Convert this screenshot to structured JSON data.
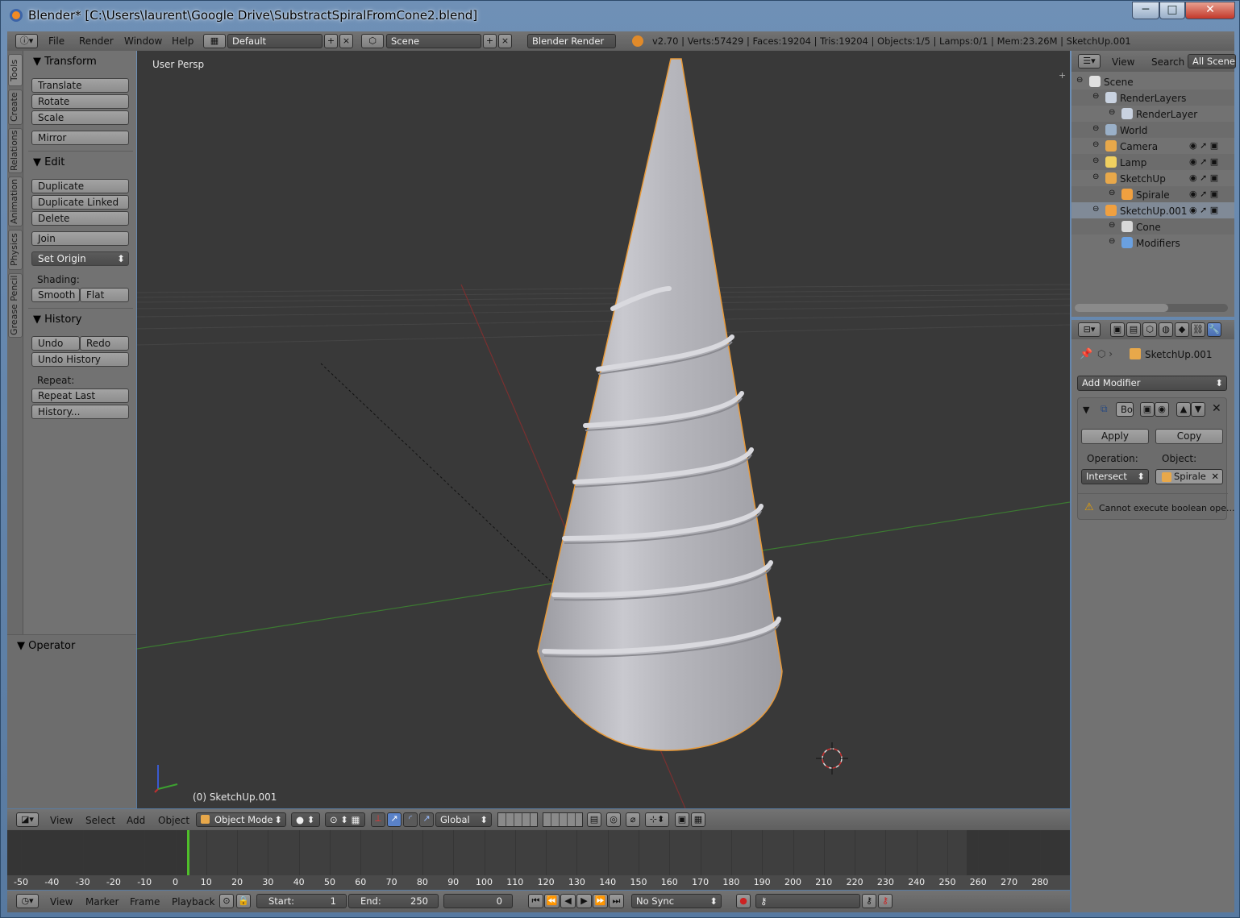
{
  "window": {
    "title": "Blender* [C:\\Users\\laurent\\Google Drive\\SubstractSpiralFromCone2.blend]",
    "controls": {
      "minimize": "─",
      "maximize": "□",
      "close": "✕"
    }
  },
  "topbar": {
    "menus": [
      "File",
      "Render",
      "Window",
      "Help"
    ],
    "layout": "Default",
    "scene": "Scene",
    "engine": "Blender Render",
    "stats": "v2.70 | Verts:57429 | Faces:19204 | Tris:19204 | Objects:1/5 | Lamps:0/1 | Mem:23.26M | SketchUp.001"
  },
  "toolshelf": {
    "tabs": [
      "Tools",
      "Create",
      "Relations",
      "Animation",
      "Physics",
      "Grease Pencil"
    ],
    "transform": {
      "title": "Transform",
      "buttons": [
        "Translate",
        "Rotate",
        "Scale",
        "Mirror"
      ]
    },
    "edit": {
      "title": "Edit",
      "buttons": [
        "Duplicate",
        "Duplicate Linked",
        "Delete",
        "Join"
      ],
      "set_origin": "Set Origin",
      "shading_label": "Shading:",
      "smooth": "Smooth",
      "flat": "Flat"
    },
    "history": {
      "title": "History",
      "undo": "Undo",
      "redo": "Redo",
      "undo_history": "Undo History",
      "repeat_label": "Repeat:",
      "repeat_last": "Repeat Last",
      "history_btn": "History..."
    },
    "operator": {
      "title": "Operator"
    }
  },
  "viewport": {
    "view_name": "User Persp",
    "object_label": "(0) SketchUp.001"
  },
  "outliner": {
    "menus": [
      "View",
      "Search",
      "All Scenes"
    ],
    "rows": [
      {
        "label": "Scene",
        "indent": 0
      },
      {
        "label": "RenderLayers",
        "indent": 1
      },
      {
        "label": "RenderLayer",
        "indent": 2
      },
      {
        "label": "World",
        "indent": 1
      },
      {
        "label": "Camera",
        "indent": 1
      },
      {
        "label": "Lamp",
        "indent": 1
      },
      {
        "label": "SketchUp",
        "indent": 1
      },
      {
        "label": "Spirale",
        "indent": 2
      },
      {
        "label": "SketchUp.001",
        "indent": 1
      },
      {
        "label": "Cone",
        "indent": 2
      },
      {
        "label": "Modifiers",
        "indent": 2
      }
    ]
  },
  "properties": {
    "object_name": "SketchUp.001",
    "add_modifier": "Add Modifier",
    "modifier_name": "Bo",
    "apply": "Apply",
    "copy": "Copy",
    "operation_label": "Operation:",
    "object_label": "Object:",
    "operation": "Intersect",
    "object": "Spirale",
    "warning": "Cannot execute boolean ope..."
  },
  "viewport_header": {
    "menus": [
      "View",
      "Select",
      "Add",
      "Object"
    ],
    "mode": "Object Mode",
    "orientation": "Global"
  },
  "timeline": {
    "ticks": [
      "-50",
      "-40",
      "-30",
      "-20",
      "-10",
      "0",
      "10",
      "20",
      "30",
      "40",
      "50",
      "60",
      "70",
      "80",
      "90",
      "100",
      "110",
      "120",
      "130",
      "140",
      "150",
      "160",
      "170",
      "180",
      "190",
      "200",
      "210",
      "220",
      "230",
      "240",
      "250",
      "260",
      "270",
      "280"
    ]
  },
  "timeline_header": {
    "menus": [
      "View",
      "Marker",
      "Frame",
      "Playback"
    ],
    "start_label": "Start:",
    "start": "1",
    "end_label": "End:",
    "end": "250",
    "current": "0",
    "sync": "No Sync"
  }
}
